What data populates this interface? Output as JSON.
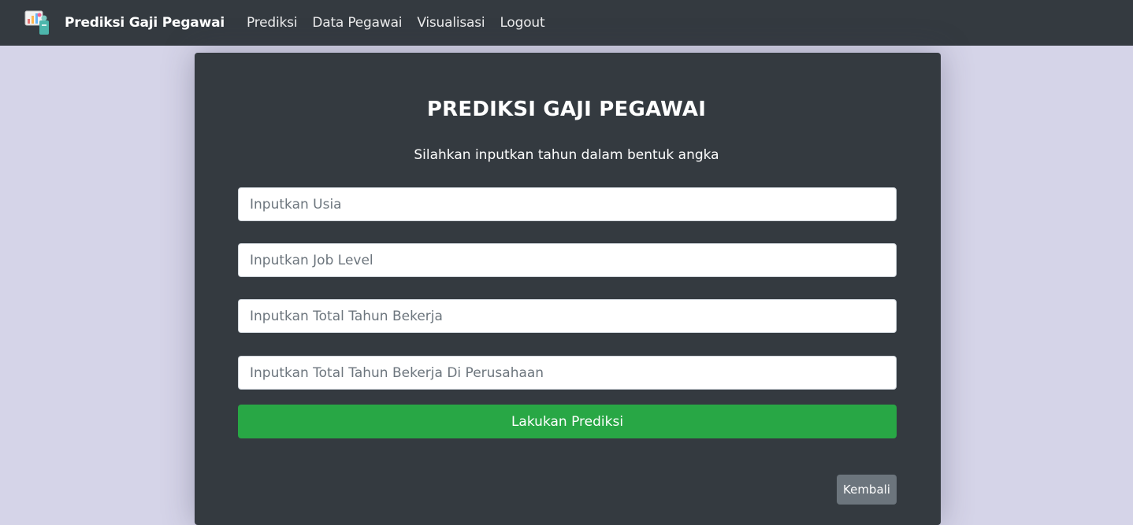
{
  "navbar": {
    "brand_logo_icon": "salary-chart-logo",
    "brand": "Prediksi Gaji Pegawai",
    "links": [
      "Prediksi",
      "Data Pegawai",
      "Visualisasi",
      "Logout"
    ]
  },
  "form": {
    "title": "PREDIKSI GAJI PEGAWAI",
    "subtitle": "Silahkan inputkan tahun dalam bentuk angka",
    "usia_placeholder": "Inputkan Usia",
    "job_level_placeholder": "Inputkan Job Level",
    "total_tahun_placeholder": "Inputkan Total Tahun Bekerja",
    "tahun_perusahaan_placeholder": "Inputkan Total Tahun Bekerja Di Perusahaan",
    "submit_label": "Lakukan Prediksi",
    "back_label": "Kembali"
  },
  "colors": {
    "navbar_bg": "#343a40",
    "page_bg": "#d5d4e8",
    "card_bg": "#343a40",
    "submit_bg": "#28a745",
    "back_bg": "#6c757d"
  }
}
